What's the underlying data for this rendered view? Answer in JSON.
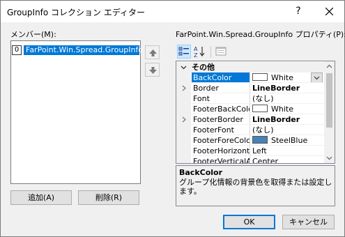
{
  "window": {
    "title": "GroupInfo コレクション エディター",
    "help_label": "?",
    "close_icon": "close-icon"
  },
  "members": {
    "label": "メンバー(M):",
    "items": [
      {
        "index": "0",
        "name": "FarPoint.Win.Spread.GroupInfo"
      }
    ],
    "move_up_icon": "arrow-up-icon",
    "move_down_icon": "arrow-down-icon",
    "add_label": "追加(A)",
    "remove_label": "削除(R)"
  },
  "properties": {
    "label": "FarPoint.Win.Spread.GroupInfo プロパティ(P):",
    "toolbar": [
      "categorized-icon",
      "alphabetical-icon",
      "property-pages-icon"
    ],
    "category": "その他",
    "rows": [
      {
        "name": "BackColor",
        "value": "White",
        "swatch": "#ffffff",
        "selected": true,
        "dropdown": true
      },
      {
        "name": "Border",
        "value": "LineBorder",
        "bold": true,
        "expandable": true
      },
      {
        "name": "Font",
        "value": "(なし)"
      },
      {
        "name": "FooterBackColc",
        "value": "White",
        "swatch": "#ffffff"
      },
      {
        "name": "FooterBorder",
        "value": "LineBorder",
        "bold": true,
        "expandable": true
      },
      {
        "name": "FooterFont",
        "value": "(なし)"
      },
      {
        "name": "FooterForeColoi",
        "value": "SteelBlue",
        "swatch": "#4682b4"
      },
      {
        "name": "FooterHorizonta",
        "value": "Left"
      },
      {
        "name": "FooterVerticalA",
        "value": "Center"
      }
    ],
    "description_title": "BackColor",
    "description_text": "グループ化情報の背景色を取得または設定します。"
  },
  "buttons": {
    "ok_label": "OK",
    "cancel_label": "キャンセル"
  },
  "colors": {
    "selection": "#0078d7",
    "dialog_bg": "#f0f0f0",
    "steelblue": "#4682b4"
  }
}
